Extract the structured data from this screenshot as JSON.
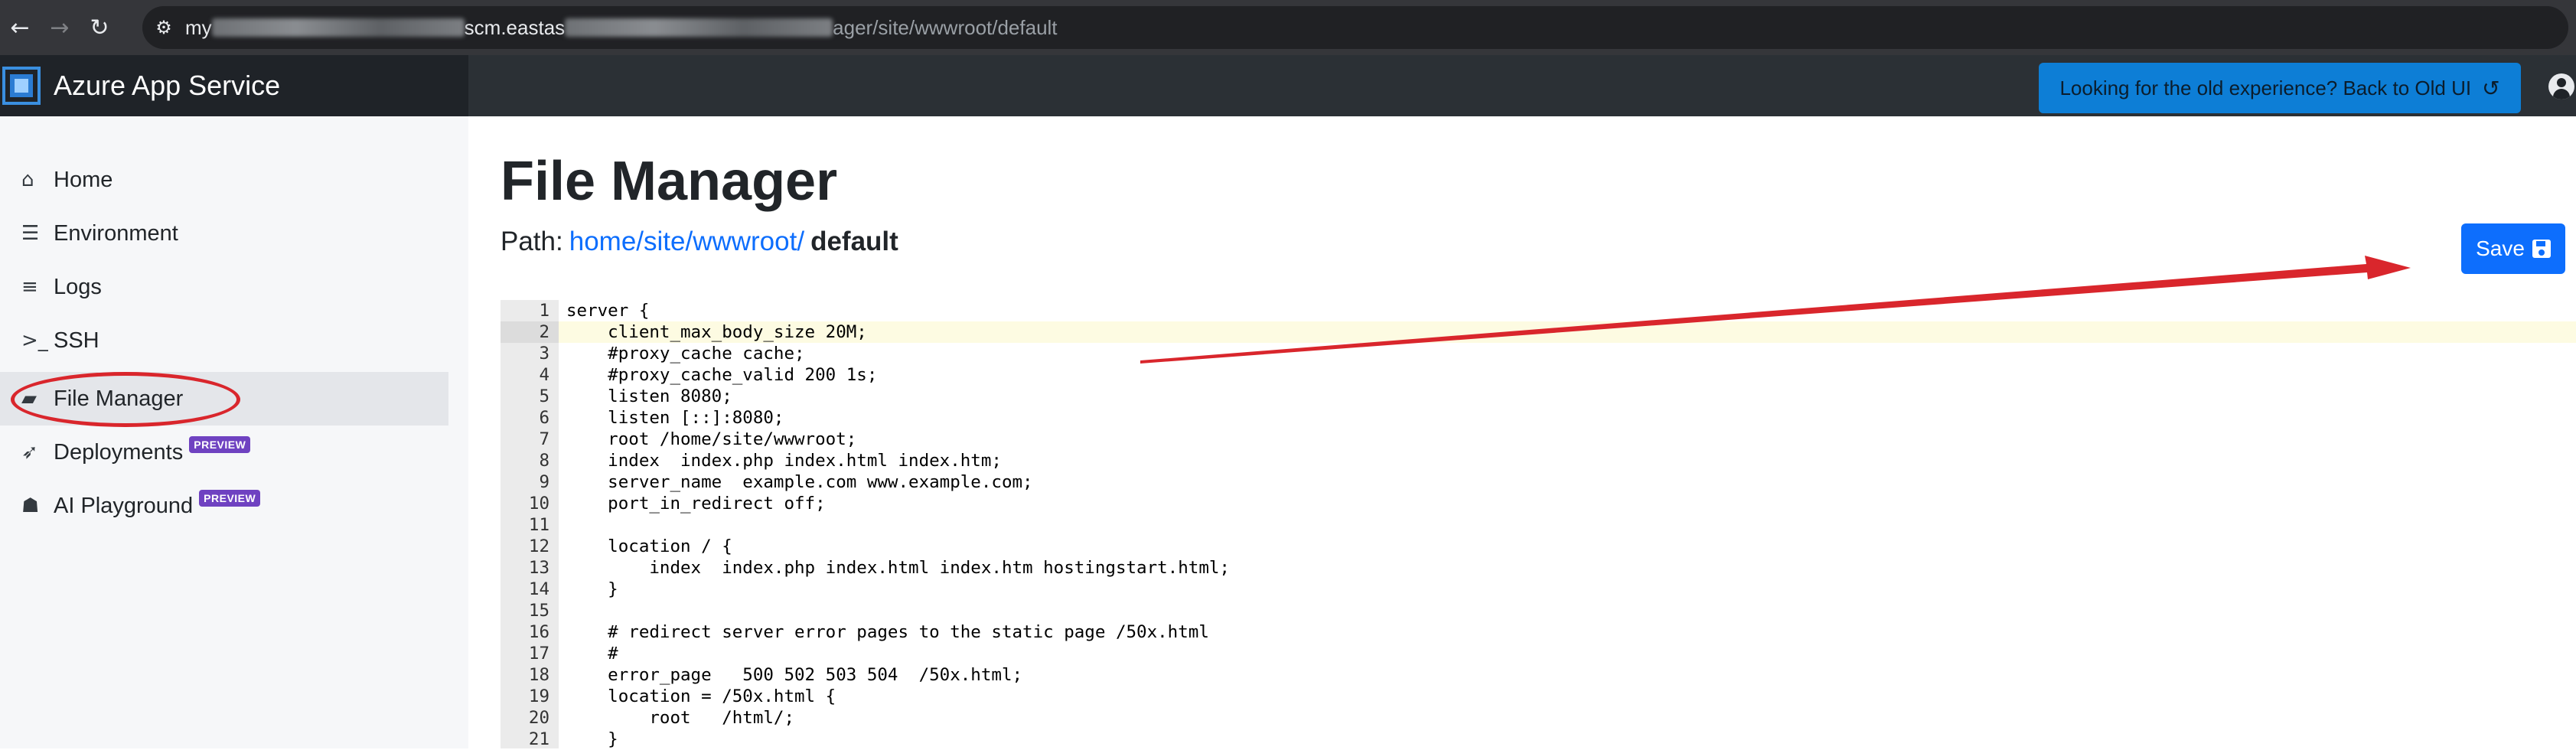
{
  "browser": {
    "back_icon": "arrow-left-icon",
    "forward_icon": "arrow-right-icon",
    "reload_icon": "reload-icon",
    "site_info_icon": "tune-icon",
    "url_prefix": "my",
    "url_middle": "scm.eastas",
    "url_suffix": "ager/site/wwwroot/default"
  },
  "header": {
    "title": "Azure App Service",
    "old_ui_label": "Looking for the old experience? Back to Old UI",
    "history_icon": "history-icon",
    "user_icon": "user-circle-icon"
  },
  "sidebar": {
    "items": [
      {
        "label": "Home",
        "icon": "home-icon",
        "glyph": "⌂",
        "badge": ""
      },
      {
        "label": "Environment",
        "icon": "list-check-icon",
        "glyph": "☰",
        "badge": ""
      },
      {
        "label": "Logs",
        "icon": "logs-icon",
        "glyph": "≡",
        "badge": ""
      },
      {
        "label": "SSH",
        "icon": "terminal-icon",
        "glyph": ">_",
        "badge": ""
      },
      {
        "label": "File Manager",
        "icon": "folder-open-icon",
        "glyph": "▰",
        "badge": ""
      },
      {
        "label": "Deployments",
        "icon": "rocket-icon",
        "glyph": "➶",
        "badge": "PREVIEW"
      },
      {
        "label": "AI Playground",
        "icon": "robot-icon",
        "glyph": "☗",
        "badge": "PREVIEW"
      }
    ],
    "active_index": 4
  },
  "main": {
    "title": "File Manager",
    "path_label": "Path:",
    "path_link": "home/site/wwwroot/",
    "path_file": "default",
    "save_label": "Save",
    "save_icon": "floppy-disk-icon"
  },
  "editor": {
    "highlighted_line": 2,
    "lines": [
      "server {",
      "    client_max_body_size 20M;",
      "    #proxy_cache cache;",
      "    #proxy_cache_valid 200 1s;",
      "    listen 8080;",
      "    listen [::]:8080;",
      "    root /home/site/wwwroot;",
      "    index  index.php index.html index.htm;",
      "    server_name  example.com www.example.com;",
      "    port_in_redirect off;",
      "",
      "    location / {",
      "        index  index.php index.html index.htm hostingstart.html;",
      "    }",
      "",
      "    # redirect server error pages to the static page /50x.html",
      "    #",
      "    error_page   500 502 503 504  /50x.html;",
      "    location = /50x.html {",
      "        root   /html/;",
      "    }"
    ]
  },
  "colors": {
    "annotation": "#d9262c",
    "primary": "#0d6efd",
    "header_bg": "#1f2328"
  }
}
